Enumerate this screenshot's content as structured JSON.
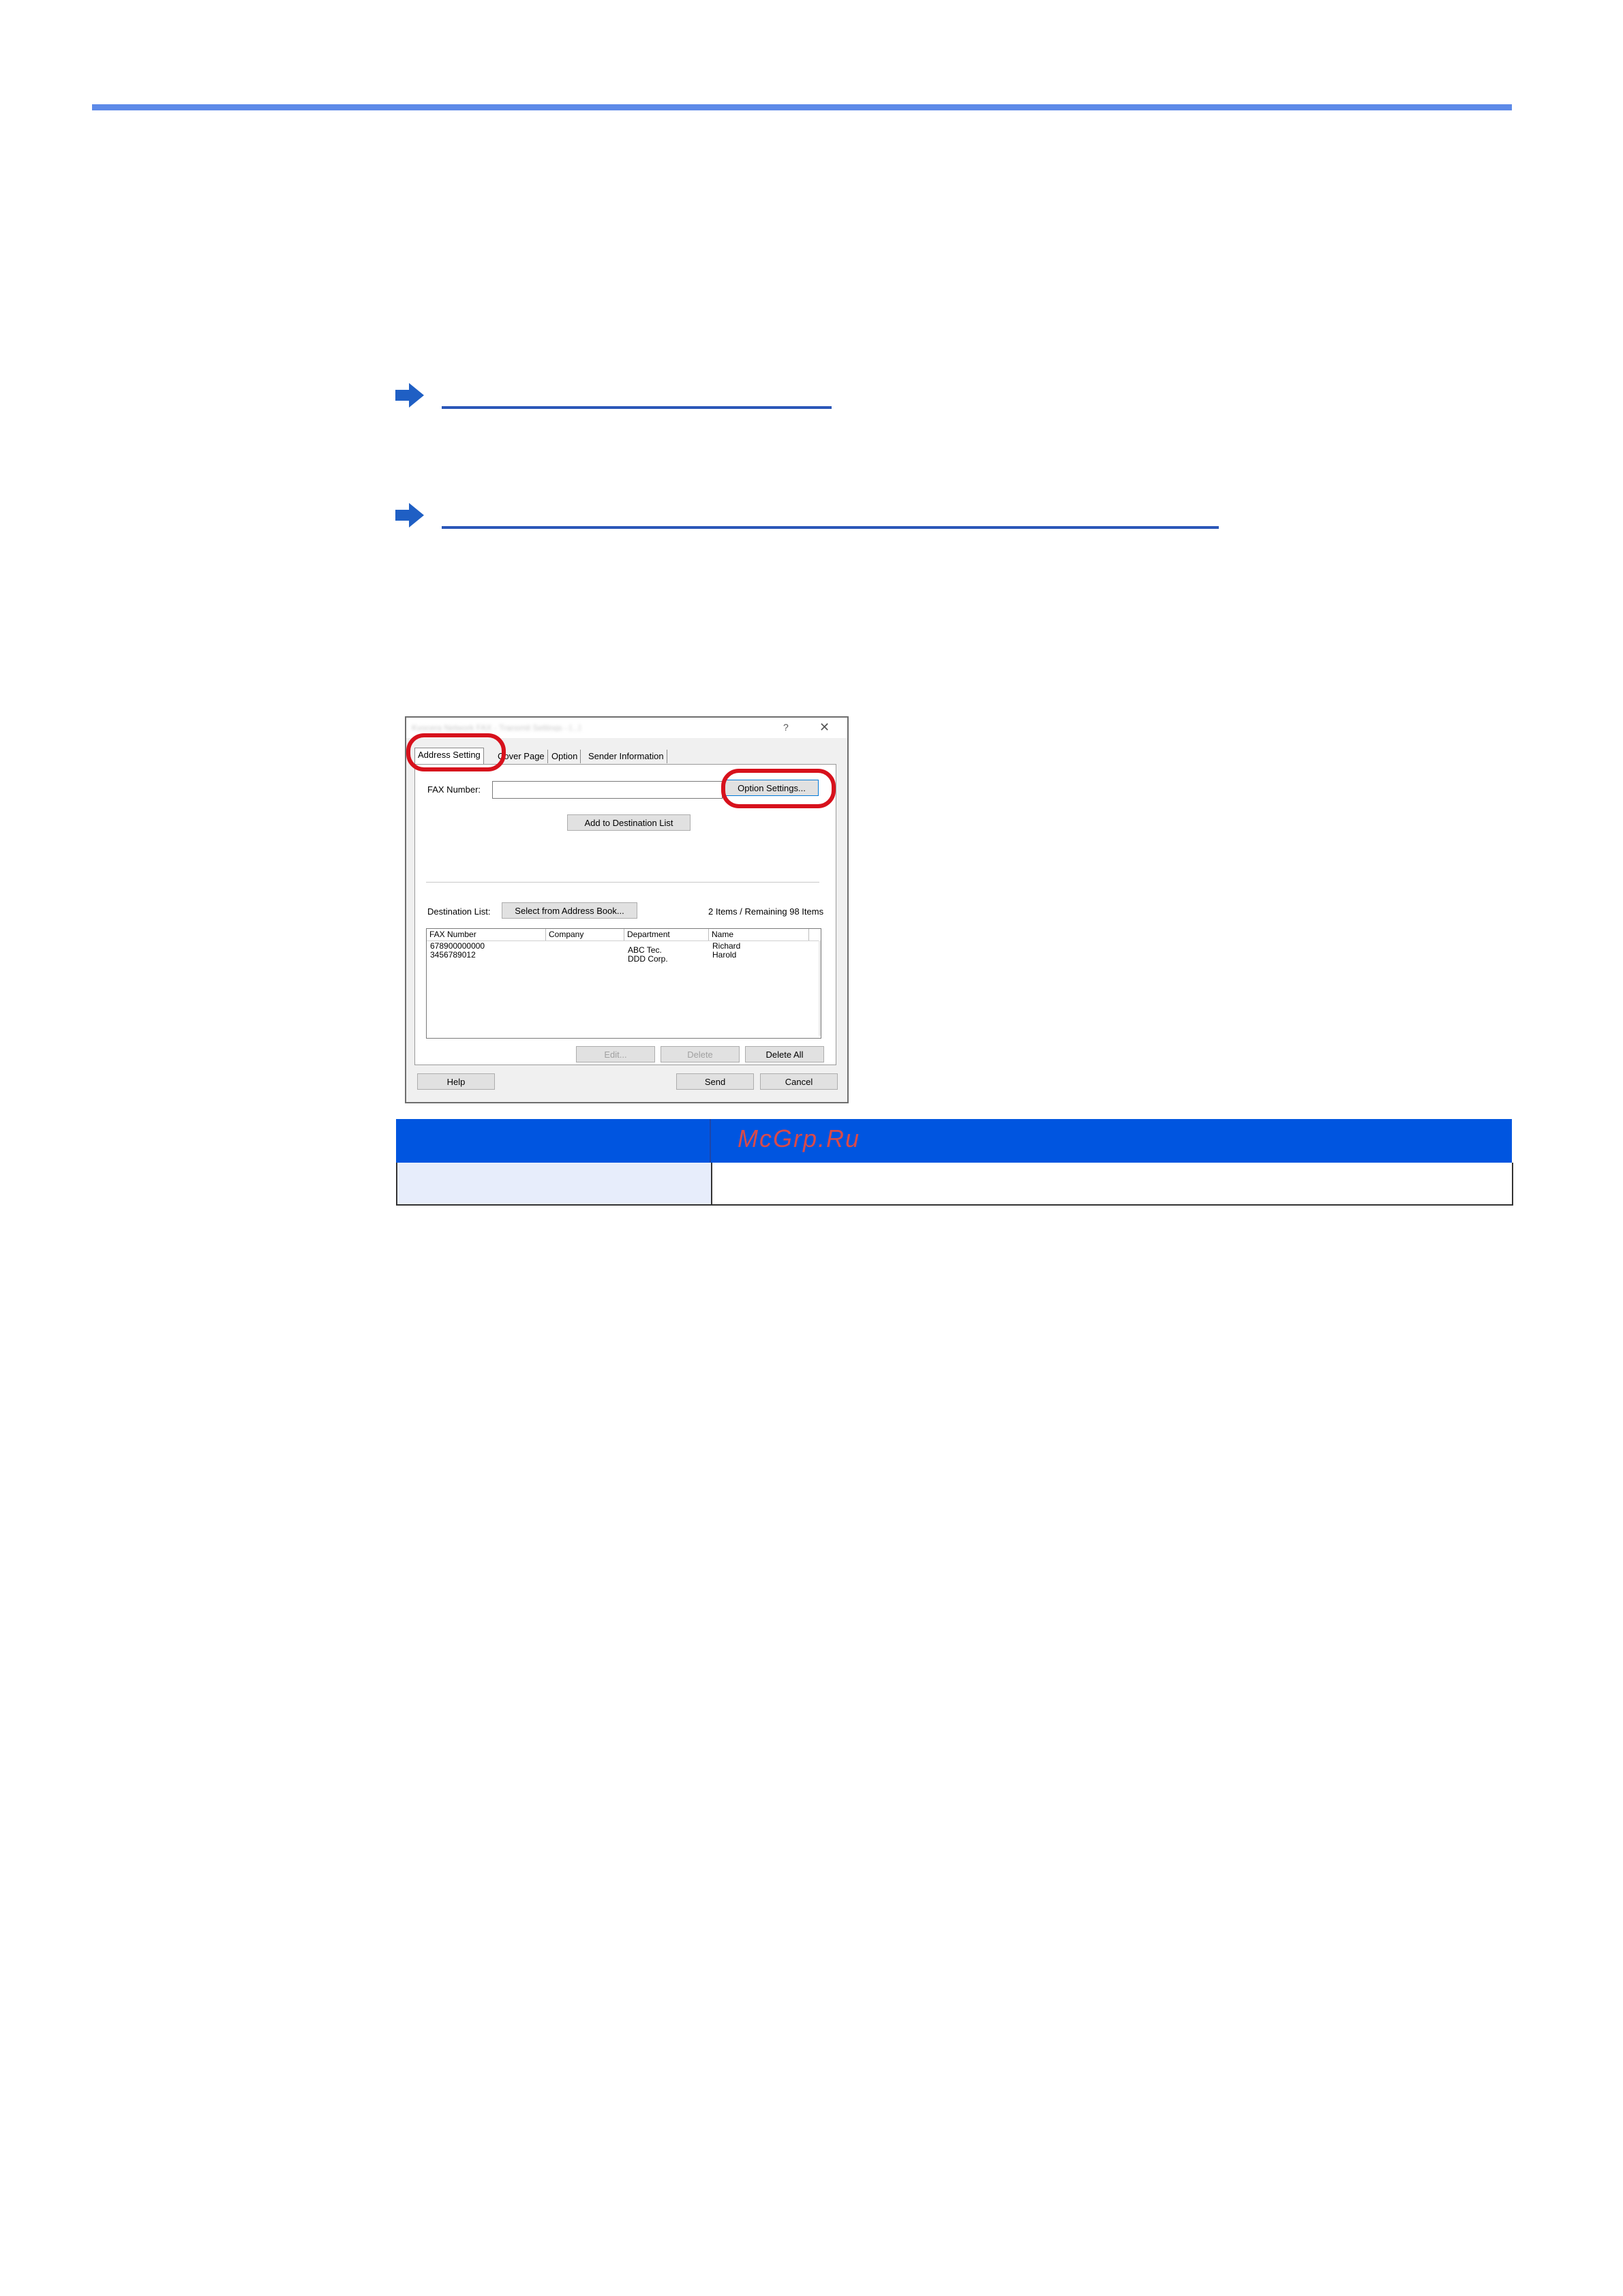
{
  "dialog": {
    "title": "Kyocera Network FAX - Transmit Settings - [...]",
    "help_glyph": "?",
    "close_glyph": "✕",
    "tabs": [
      {
        "label": "Address Setting",
        "active": true
      },
      {
        "label": "Cover Page",
        "active": false
      },
      {
        "label": "Option",
        "active": false
      },
      {
        "label": "Sender Information",
        "active": false
      }
    ],
    "fax_number_label": "FAX Number:",
    "fax_number_value": "",
    "option_settings_button": "Option Settings...",
    "add_to_destination_button": "Add to Destination List",
    "destination_list_label": "Destination List:",
    "select_address_book_button": "Select from Address Book...",
    "items_count": "2 Items / Remaining 98 Items",
    "columns": [
      "FAX Number",
      "Company",
      "Department",
      "Name"
    ],
    "rows": [
      {
        "fax": "678900000000",
        "company": "",
        "department": "ABC Tec.",
        "name": "Richard"
      },
      {
        "fax": "3456789012",
        "company": "",
        "department": "DDD Corp.",
        "name": "Harold"
      }
    ],
    "edit_button": "Edit...",
    "delete_button": "Delete",
    "delete_all_button": "Delete All",
    "help_button": "Help",
    "send_button": "Send",
    "cancel_button": "Cancel"
  },
  "table": {
    "watermark": "McGrp.Ru"
  },
  "colors": {
    "accent_rule": "#5d8ae8",
    "link": "#2b57b8",
    "highlight": "#d7111c",
    "table_header": "#0055e0"
  }
}
